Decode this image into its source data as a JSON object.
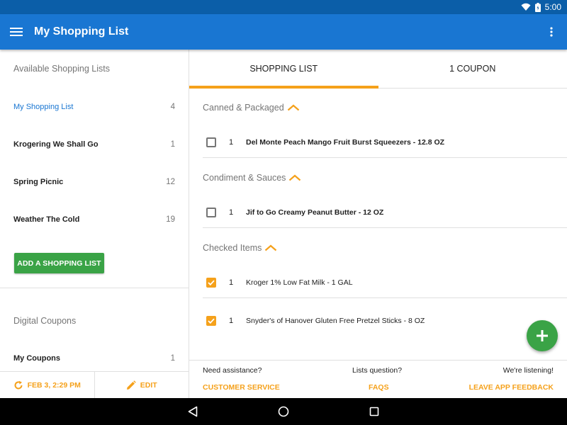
{
  "status_bar": {
    "time": "5:00",
    "icons": [
      "wifi-icon",
      "battery-icon"
    ]
  },
  "app_bar": {
    "title": "My Shopping List",
    "menu_icon": "hamburger-menu-icon",
    "more_icon": "more-vert-icon"
  },
  "sidebar": {
    "lists_title": "Available Shopping Lists",
    "lists": [
      {
        "name": "My Shopping List",
        "count": "4",
        "active": true
      },
      {
        "name": "Krogering We Shall Go",
        "count": "1",
        "active": false
      },
      {
        "name": "Spring Picnic",
        "count": "12",
        "active": false
      },
      {
        "name": "Weather The Cold",
        "count": "19",
        "active": false
      }
    ],
    "add_button": "ADD A SHOPPING LIST",
    "coupons_title": "Digital Coupons",
    "coupons": {
      "name": "My Coupons",
      "count": "1"
    },
    "footer": {
      "sync_label": "FEB 3, 2:29 PM",
      "edit_label": "EDIT"
    }
  },
  "tabs": [
    {
      "label": "SHOPPING LIST",
      "active": true
    },
    {
      "label": "1 COUPON",
      "active": false
    }
  ],
  "categories": [
    {
      "title": "Canned & Packaged",
      "items": [
        {
          "qty": "1",
          "name": "Del Monte Peach Mango Fruit Burst Squeezers - 12.8 OZ",
          "checked": false
        }
      ]
    },
    {
      "title": "Condiment & Sauces",
      "items": [
        {
          "qty": "1",
          "name": "Jif to Go Creamy Peanut Butter - 12 OZ",
          "checked": false
        }
      ]
    },
    {
      "title": "Checked Items",
      "items": [
        {
          "qty": "1",
          "name": "Kroger 1% Low Fat Milk - 1 GAL",
          "checked": true
        },
        {
          "qty": "1",
          "name": "Snyder's of Hanover Gluten Free Pretzel Sticks - 8 OZ",
          "checked": true
        }
      ]
    }
  ],
  "help": {
    "need_assistance": "Need assistance?",
    "lists_question": "Lists question?",
    "listening": "We're listening!",
    "customer_service": "CUSTOMER SERVICE",
    "faqs": "FAQS",
    "feedback": "LEAVE APP FEEDBACK"
  },
  "colors": {
    "primary": "#1976d2",
    "status_bar": "#0b5ea8",
    "accent": "#f5a11b",
    "green": "#3aa346"
  }
}
